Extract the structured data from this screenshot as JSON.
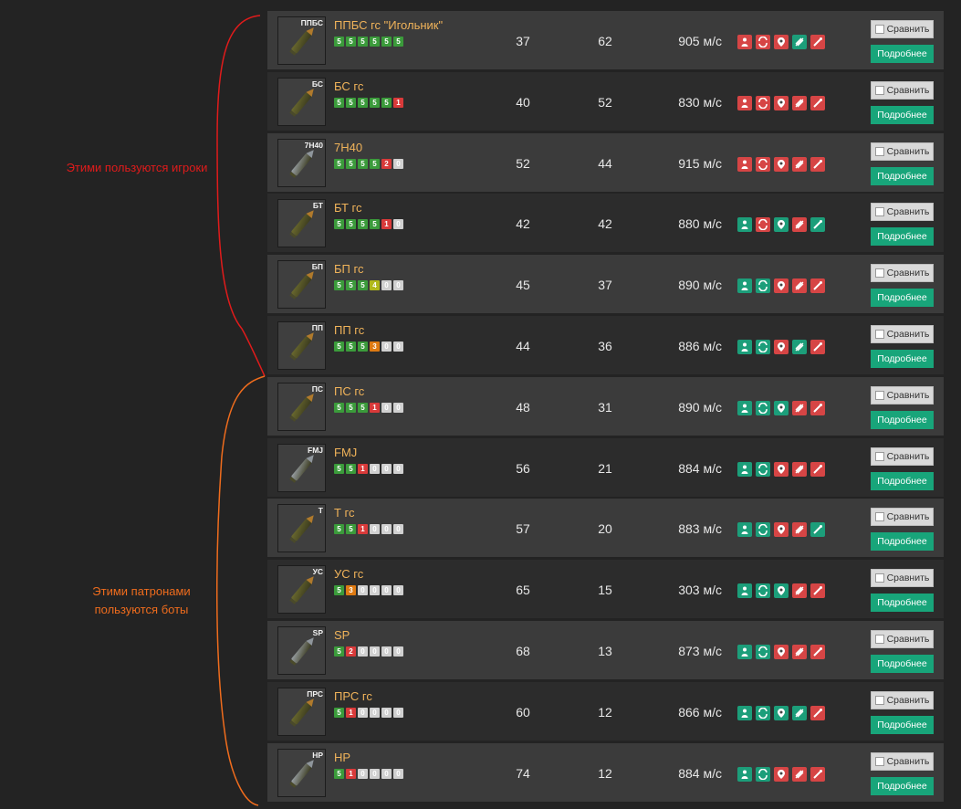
{
  "annotations": {
    "players": "Этими пользуются игроки",
    "bots": "Этими патронами пользуются боты",
    "colors": {
      "players": "#e01b1b",
      "bots": "#ef6c1d"
    }
  },
  "buttons": {
    "compare": "Сравнить",
    "details": "Подробнее"
  },
  "rows": [
    {
      "code": "ППБС",
      "name": "ППБС гс \"Игольник\"",
      "effs": [
        [
          "5",
          "g"
        ],
        [
          "5",
          "g"
        ],
        [
          "5",
          "g"
        ],
        [
          "5",
          "g"
        ],
        [
          "5",
          "g"
        ],
        [
          "5",
          "g"
        ]
      ],
      "v1": "37",
      "v2": "62",
      "vel": "905 м/с",
      "icons": [
        "red",
        "red",
        "red",
        "grn",
        "red"
      ],
      "bullet": "brass"
    },
    {
      "code": "БС",
      "name": "БС гс",
      "effs": [
        [
          "5",
          "g"
        ],
        [
          "5",
          "g"
        ],
        [
          "5",
          "g"
        ],
        [
          "5",
          "g"
        ],
        [
          "5",
          "g"
        ],
        [
          "1",
          "r"
        ]
      ],
      "v1": "40",
      "v2": "52",
      "vel": "830 м/с",
      "icons": [
        "red",
        "red",
        "red",
        "red",
        "red"
      ],
      "bullet": "brass"
    },
    {
      "code": "7Н40",
      "name": "7Н40",
      "effs": [
        [
          "5",
          "g"
        ],
        [
          "5",
          "g"
        ],
        [
          "5",
          "g"
        ],
        [
          "5",
          "g"
        ],
        [
          "2",
          "r"
        ],
        [
          "0",
          "s"
        ]
      ],
      "v1": "52",
      "v2": "44",
      "vel": "915 м/с",
      "icons": [
        "red",
        "red",
        "red",
        "red",
        "red"
      ],
      "bullet": "steel"
    },
    {
      "code": "БТ",
      "name": "БТ гс",
      "effs": [
        [
          "5",
          "g"
        ],
        [
          "5",
          "g"
        ],
        [
          "5",
          "g"
        ],
        [
          "5",
          "g"
        ],
        [
          "1",
          "r"
        ],
        [
          "0",
          "s"
        ]
      ],
      "v1": "42",
      "v2": "42",
      "vel": "880 м/с",
      "icons": [
        "grn",
        "red",
        "grn",
        "red",
        "grn"
      ],
      "bullet": "brass"
    },
    {
      "code": "БП",
      "name": "БП гс",
      "effs": [
        [
          "5",
          "g"
        ],
        [
          "5",
          "g"
        ],
        [
          "5",
          "g"
        ],
        [
          "4",
          "y"
        ],
        [
          "0",
          "s"
        ],
        [
          "0",
          "s"
        ]
      ],
      "v1": "45",
      "v2": "37",
      "vel": "890 м/с",
      "icons": [
        "grn",
        "grn",
        "red",
        "red",
        "red"
      ],
      "bullet": "brass"
    },
    {
      "code": "ПП",
      "name": "ПП гс",
      "effs": [
        [
          "5",
          "g"
        ],
        [
          "5",
          "g"
        ],
        [
          "5",
          "g"
        ],
        [
          "3",
          "o"
        ],
        [
          "0",
          "s"
        ],
        [
          "0",
          "s"
        ]
      ],
      "v1": "44",
      "v2": "36",
      "vel": "886 м/с",
      "icons": [
        "grn",
        "grn",
        "red",
        "grn",
        "red"
      ],
      "bullet": "brass"
    },
    {
      "code": "ПС",
      "name": "ПС гс",
      "effs": [
        [
          "5",
          "g"
        ],
        [
          "5",
          "g"
        ],
        [
          "5",
          "g"
        ],
        [
          "1",
          "r"
        ],
        [
          "0",
          "s"
        ],
        [
          "0",
          "s"
        ]
      ],
      "v1": "48",
      "v2": "31",
      "vel": "890 м/с",
      "icons": [
        "grn",
        "grn",
        "grn",
        "red",
        "red"
      ],
      "bullet": "brass"
    },
    {
      "code": "FMJ",
      "name": "FMJ",
      "effs": [
        [
          "5",
          "g"
        ],
        [
          "5",
          "g"
        ],
        [
          "1",
          "r"
        ],
        [
          "0",
          "s"
        ],
        [
          "0",
          "s"
        ],
        [
          "0",
          "s"
        ]
      ],
      "v1": "56",
      "v2": "21",
      "vel": "884 м/с",
      "icons": [
        "grn",
        "grn",
        "red",
        "red",
        "red"
      ],
      "bullet": "steel"
    },
    {
      "code": "Т",
      "name": "Т гс",
      "effs": [
        [
          "5",
          "g"
        ],
        [
          "5",
          "g"
        ],
        [
          "1",
          "r"
        ],
        [
          "0",
          "s"
        ],
        [
          "0",
          "s"
        ],
        [
          "0",
          "s"
        ]
      ],
      "v1": "57",
      "v2": "20",
      "vel": "883 м/с",
      "icons": [
        "grn",
        "grn",
        "red",
        "red",
        "grn"
      ],
      "bullet": "brass"
    },
    {
      "code": "УС",
      "name": "УС гс",
      "effs": [
        [
          "5",
          "g"
        ],
        [
          "3",
          "o"
        ],
        [
          "0",
          "s"
        ],
        [
          "0",
          "s"
        ],
        [
          "0",
          "s"
        ],
        [
          "0",
          "s"
        ]
      ],
      "v1": "65",
      "v2": "15",
      "vel": "303 м/с",
      "icons": [
        "grn",
        "grn",
        "grn",
        "red",
        "red"
      ],
      "bullet": "brass"
    },
    {
      "code": "SP",
      "name": "SP",
      "effs": [
        [
          "5",
          "g"
        ],
        [
          "2",
          "r"
        ],
        [
          "0",
          "s"
        ],
        [
          "0",
          "s"
        ],
        [
          "0",
          "s"
        ],
        [
          "0",
          "s"
        ]
      ],
      "v1": "68",
      "v2": "13",
      "vel": "873 м/с",
      "icons": [
        "grn",
        "grn",
        "red",
        "red",
        "red"
      ],
      "bullet": "steel"
    },
    {
      "code": "ПРС",
      "name": "ПРС гс",
      "effs": [
        [
          "5",
          "g"
        ],
        [
          "1",
          "r"
        ],
        [
          "0",
          "s"
        ],
        [
          "0",
          "s"
        ],
        [
          "0",
          "s"
        ],
        [
          "0",
          "s"
        ]
      ],
      "v1": "60",
      "v2": "12",
      "vel": "866 м/с",
      "icons": [
        "grn",
        "grn",
        "grn",
        "grn",
        "red"
      ],
      "bullet": "brass"
    },
    {
      "code": "HP",
      "name": "HP",
      "effs": [
        [
          "5",
          "g"
        ],
        [
          "1",
          "r"
        ],
        [
          "0",
          "s"
        ],
        [
          "0",
          "s"
        ],
        [
          "0",
          "s"
        ],
        [
          "0",
          "s"
        ]
      ],
      "v1": "74",
      "v2": "12",
      "vel": "884 м/с",
      "icons": [
        "grn",
        "grn",
        "red",
        "red",
        "red"
      ],
      "bullet": "steel"
    }
  ],
  "icon_names": [
    "armor-icon",
    "ricochet-icon",
    "fragment-icon",
    "tracer-icon",
    "bleed-icon"
  ]
}
